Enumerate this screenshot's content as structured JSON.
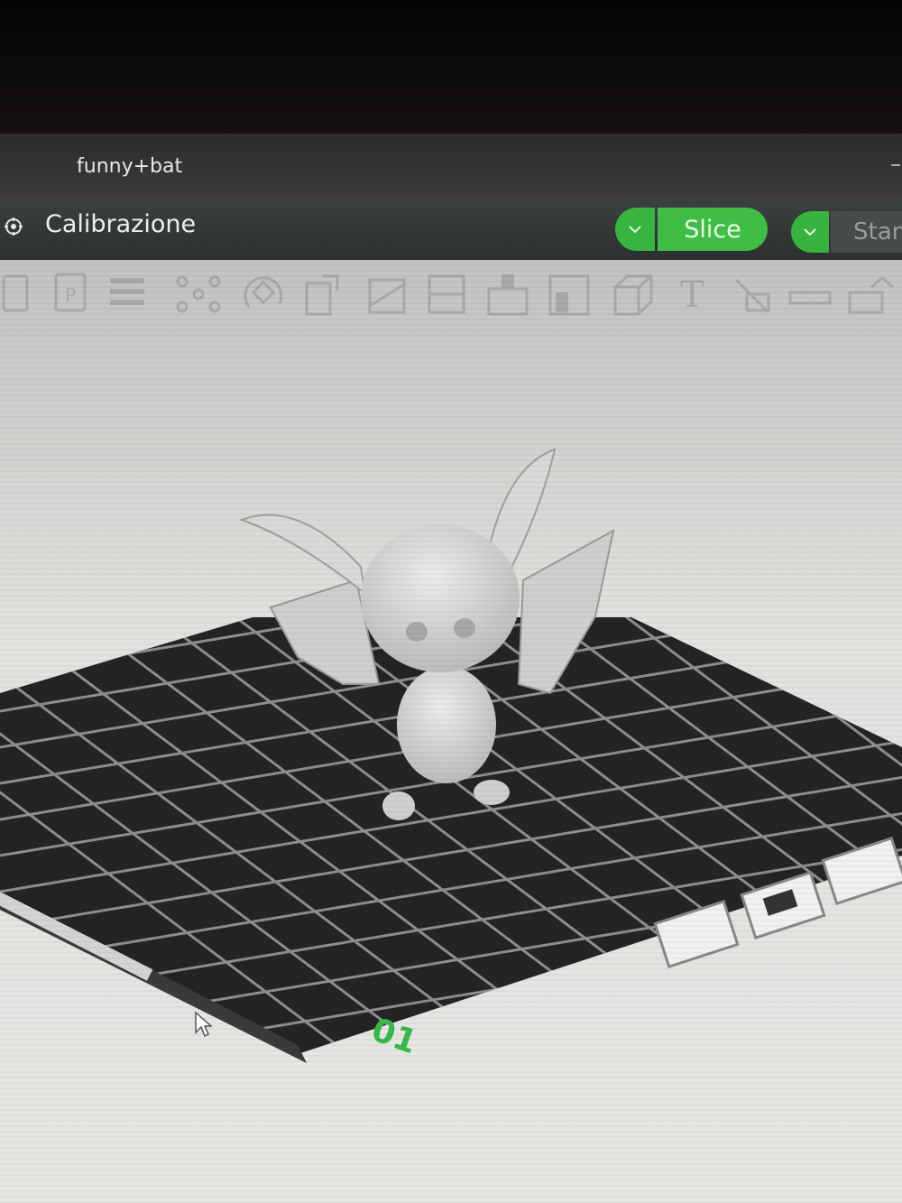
{
  "window": {
    "title": "funny+bat"
  },
  "menubar": {
    "tab_label": "Calibrazione"
  },
  "actions": {
    "slice_label": "Slice",
    "print_label": "Stam"
  },
  "toolbar": {
    "tools": [
      "save-icon",
      "plate-icon",
      "layers-icon",
      "arrange-icon",
      "rotate-icon",
      "scale-icon",
      "cut-icon",
      "split-icon",
      "support-icon",
      "seam-icon",
      "color-icon",
      "cube-icon",
      "text-icon",
      "measure-icon",
      "assembly-icon",
      "orient-icon"
    ]
  },
  "plate": {
    "number": "01"
  },
  "colors": {
    "accent_green": "#3fbd45",
    "titlebar": "#333231",
    "menubar": "#343838",
    "viewport": "#e2e2df",
    "plate": "#222222",
    "grid_lines": "#8e8e8e",
    "model": "#d6d6d4"
  }
}
